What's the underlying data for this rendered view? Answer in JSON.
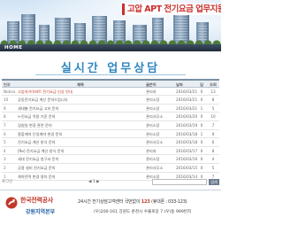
{
  "banner": {
    "title": "고압 APT 전기요금 업무지원",
    "nav_home": "HOME"
  },
  "section": {
    "heading": "실시간 업무상담"
  },
  "table": {
    "columns": [
      "번호",
      "제목",
      "글쓴이",
      "날짜",
      "답",
      "조회"
    ],
    "rows": [
      {
        "no": "Notice",
        "title": "고압자가아파트 전기요금 인상 안내",
        "author": "관리자",
        "date": "2016/03/21",
        "replies": "0",
        "views": "13",
        "notice": true
      },
      {
        "no": "10",
        "title": "공동전기요금 계산 문의드립니다",
        "author": "관리소장",
        "date": "2016/03/21",
        "replies": "0",
        "views": "8"
      },
      {
        "no": "9",
        "title": "세대별 전기요금 고지 문의",
        "author": "관리소장",
        "date": "2016/03/21",
        "replies": "1",
        "views": "5"
      },
      {
        "no": "8",
        "title": "누진요금 적용 기준 문의",
        "author": "관리사무소",
        "date": "2016/03/20",
        "replies": "0",
        "views": "10"
      },
      {
        "no": "7",
        "title": "검침일 변경 관련 문의",
        "author": "관리소장",
        "date": "2016/03/19",
        "replies": "0",
        "views": "7"
      },
      {
        "no": "6",
        "title": "종합계약 단일계약 변경 문의",
        "author": "관리소장",
        "date": "2016/03/18",
        "replies": "1",
        "views": "9"
      },
      {
        "no": "5",
        "title": "전기요금 계산 방식 문의",
        "author": "관리사무소",
        "date": "2016/03/18",
        "replies": "0",
        "views": "6"
      },
      {
        "no": "4",
        "title": "[Re] 전기요금 계산 방식 문의",
        "author": "관리자",
        "date": "2016/03/17",
        "replies": "0",
        "views": "8"
      },
      {
        "no": "3",
        "title": "세대 전기요금 청구서 문의",
        "author": "관리소장",
        "date": "2016/03/16",
        "replies": "0",
        "views": "4"
      },
      {
        "no": "2",
        "title": "공용 설비 전기요금 문의",
        "author": "관리사무소",
        "date": "2016/03/15",
        "replies": "0",
        "views": "5"
      },
      {
        "no": "1",
        "title": "계약전력 변경 절차 문의",
        "author": "관리소장",
        "date": "2016/03/14",
        "replies": "0",
        "views": "7"
      }
    ]
  },
  "pager": {
    "login": "로그인",
    "nav": "◀ 1 ▶",
    "search_button": "검색"
  },
  "footer": {
    "org": "한국전력공사",
    "branch": "강원지역본부",
    "phone_prefix": "24시간 전기상담고객센터 국번없이",
    "phone_number": "123",
    "phone_suffix": "(휴대폰 : 033-123)",
    "address": "(우)200-161 강원도 춘천시 수풀로길 7 (우)동 999번지"
  },
  "colors": {
    "title_red": "#c9302c",
    "heading_blue": "#2e86c1",
    "brand_red": "#c0392b",
    "brand_blue": "#1f5fa3"
  }
}
